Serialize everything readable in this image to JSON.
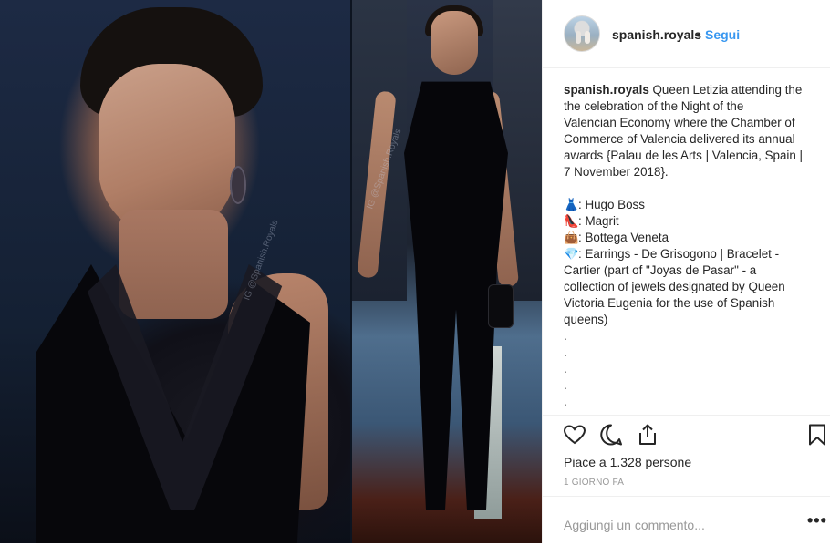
{
  "post": {
    "username": "spanish.royals",
    "dot": "•",
    "follow_label": "Segui",
    "watermark": "IG @Spanish.Royals"
  },
  "caption": {
    "username": "spanish.royals",
    "lines": [
      "Queen Letizia attending the",
      "the celebration of the Night of the",
      "Valencian Economy where the Chamber of",
      "Commerce of Valencia delivered its annual",
      "awards {Palau de les Arts | Valencia, Spain |",
      "7 November 2018}."
    ],
    "items": [
      {
        "icon": "dress-icon",
        "glyph": "👗",
        "text": ": Hugo Boss"
      },
      {
        "icon": "shoe-icon",
        "glyph": "👠",
        "text": ": Magrit"
      },
      {
        "icon": "handbag-icon",
        "glyph": "👜",
        "text": ": Bottega Veneta"
      }
    ],
    "jewels_lines": [
      ": Earrings - De Grisogono | Bracelet -",
      "Cartier (part of \"Joyas de Pasar\" - a",
      "collection of jewels designated by Queen",
      "Victoria Eugenia for the use of Spanish",
      "queens)"
    ],
    "jewels_glyph": "💎",
    "dots": [
      ".",
      ".",
      ".",
      ".",
      "."
    ]
  },
  "actions": {
    "likes": "Piace a 1.328 persone",
    "time": "1 GIORNO FA",
    "comment_placeholder": "Aggiungi un commento...",
    "more": "•••"
  }
}
